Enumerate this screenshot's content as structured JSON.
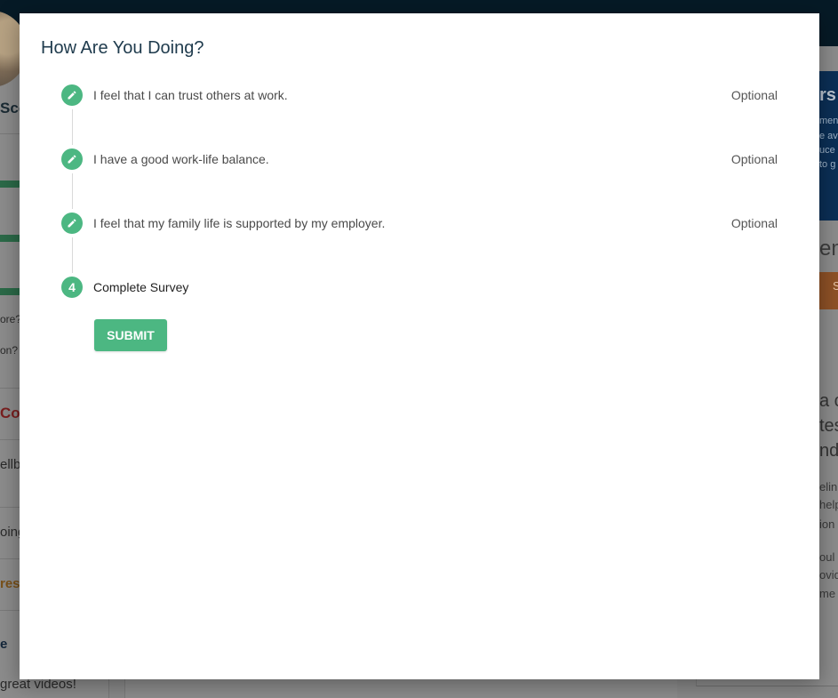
{
  "background": {
    "left_fragments": {
      "name": "Sco",
      "q1": "ore?",
      "q2": "on?",
      "link1": "Co",
      "item1": "ellbe",
      "item2": "oing",
      "link2": "res",
      "item3": "e",
      "item4": "great videos!"
    },
    "right_fragments": {
      "heading": "rs",
      "banner_line1": "men",
      "banner_line2": "e av",
      "banner_line3": "uce",
      "banner_line4": "to g",
      "title": "em",
      "button": "S",
      "big1": "a c",
      "big2": "tes",
      "big3": "nd",
      "p1": "elin",
      "p2": "help",
      "p3": "ion",
      "p4": "oul",
      "p5": "ovid",
      "p6": "me"
    }
  },
  "modal": {
    "title": "How Are You Doing?",
    "steps": [
      {
        "label": "I feel that I can trust others at work.",
        "optional": "Optional",
        "icon": "pencil-icon"
      },
      {
        "label": "I have a good work-life balance.",
        "optional": "Optional",
        "icon": "pencil-icon"
      },
      {
        "label": "I feel that my family life is supported by my employer.",
        "optional": "Optional",
        "icon": "pencil-icon"
      },
      {
        "label": "Complete Survey",
        "number": "4"
      }
    ],
    "submit_label": "SUBMIT"
  },
  "colors": {
    "accent": "#4cb782",
    "title": "#1f3b4d",
    "overlay_topbar": "#061a26"
  }
}
